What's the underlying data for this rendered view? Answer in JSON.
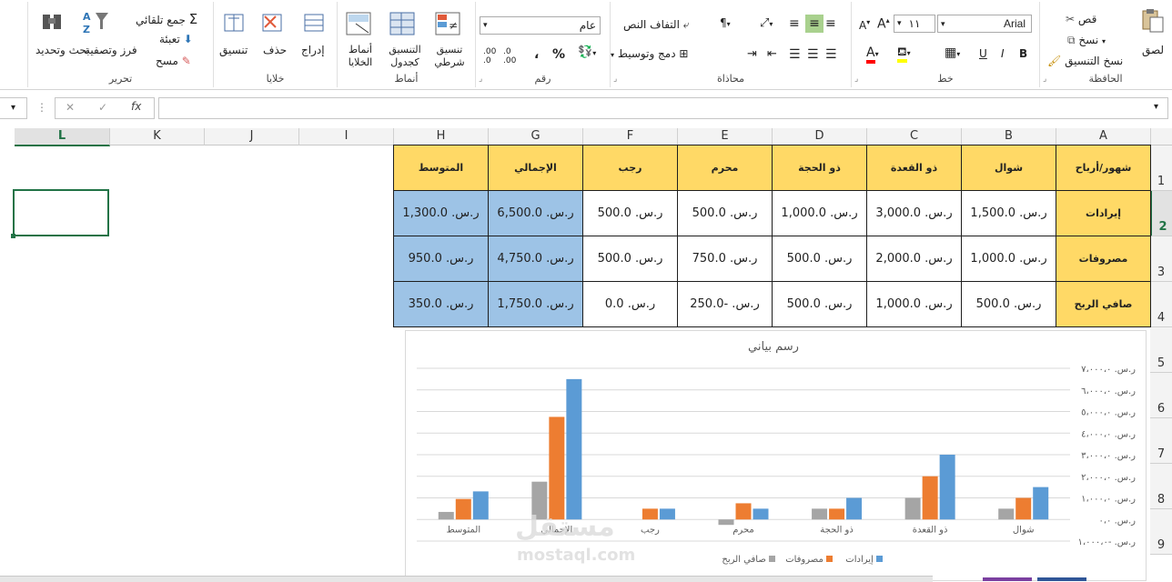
{
  "ribbon": {
    "clipboard": {
      "label": "الحافظة",
      "paste": "لصق",
      "cut": "قص",
      "copy": "نسخ",
      "format_painter": "نسخ التنسيق"
    },
    "font": {
      "label": "خط",
      "name": "Arial",
      "size": "١١",
      "bold": "B",
      "italic": "I",
      "underline": "U"
    },
    "alignment": {
      "label": "محاذاة",
      "wrap": "التفاف النص",
      "merge": "دمج وتوسيط"
    },
    "number": {
      "label": "رقم",
      "format": "عام",
      "percent": "%",
      "comma": "،"
    },
    "styles": {
      "label": "أنماط",
      "conditional": "تنسيق شرطي",
      "table": "التنسيق كجدول",
      "cell_styles": "أنماط الخلايا"
    },
    "cells": {
      "label": "خلايا",
      "insert": "إدراج",
      "delete": "حذف",
      "format": "تنسيق"
    },
    "editing": {
      "label": "تحرير",
      "autosum": "جمع تلقائي",
      "fill": "تعبئة",
      "clear": "مسح",
      "sort": "فرز وتصفية",
      "find": "بحث وتحديد"
    }
  },
  "formula_bar": {
    "cancel": "✕",
    "enter": "✓",
    "fx": "fx",
    "value": ""
  },
  "columns": [
    "L",
    "K",
    "J",
    "I",
    "H",
    "G",
    "F",
    "E",
    "D",
    "C",
    "B",
    "A"
  ],
  "rows": [
    "1",
    "2",
    "3",
    "4",
    "5",
    "6",
    "7",
    "8",
    "9"
  ],
  "table": {
    "headers": [
      "شهور/أرباح",
      "شوال",
      "ذو القعدة",
      "ذو الحجة",
      "محرم",
      "رجب",
      "الإجمالي",
      "المتوسط"
    ],
    "rows": [
      {
        "label": "إيرادات",
        "values": [
          "ر.س. 1,500.0",
          "ر.س. 3,000.0",
          "ر.س. 1,000.0",
          "ر.س. 500.0",
          "ر.س. 500.0",
          "ر.س. 6,500.0",
          "ر.س. 1,300.0"
        ]
      },
      {
        "label": "مصروفات",
        "values": [
          "ر.س. 1,000.0",
          "ر.س. 2,000.0",
          "ر.س. 500.0",
          "ر.س. 750.0",
          "ر.س. 500.0",
          "ر.س. 4,750.0",
          "ر.س. 950.0"
        ]
      },
      {
        "label": "صافي الربح",
        "values": [
          "ر.س. 500.0",
          "ر.س. 1,000.0",
          "ر.س. 500.0",
          "ر.س. -250.0",
          "ر.س. 0.0",
          "ر.س. 1,750.0",
          "ر.س. 350.0"
        ]
      }
    ]
  },
  "chart_data": {
    "type": "bar",
    "title": "رسم بياني",
    "categories": [
      "شوال",
      "ذو القعدة",
      "ذو الحجة",
      "محرم",
      "رجب",
      "الإجمالي",
      "المتوسط"
    ],
    "series": [
      {
        "name": "إيرادات",
        "color": "#5b9bd5",
        "values": [
          1500,
          3000,
          1000,
          500,
          500,
          6500,
          1300
        ]
      },
      {
        "name": "مصروفات",
        "color": "#ed7d31",
        "values": [
          1000,
          2000,
          500,
          750,
          500,
          4750,
          950
        ]
      },
      {
        "name": "صافي الربح",
        "color": "#a5a5a5",
        "values": [
          500,
          1000,
          500,
          -250,
          0,
          1750,
          350
        ]
      }
    ],
    "ylim": [
      -1000,
      7000
    ],
    "ytick_labels": [
      "ر.س. ٧،٠٠٠،٠",
      "ر.س. ٦،٠٠٠،٠",
      "ر.س. ٥،٠٠٠،٠",
      "ر.س. ٤،٠٠٠،٠",
      "ر.س. ٣،٠٠٠،٠",
      "ر.س. ٢،٠٠٠،٠",
      "ر.س. ١،٠٠٠،٠",
      "ر.س. ٠،٠",
      "ر.س. -١،٠٠٠،٠"
    ],
    "grid": true,
    "legend": "bottom"
  },
  "watermark": {
    "text": "مستقل",
    "url": "mostaql.com"
  }
}
